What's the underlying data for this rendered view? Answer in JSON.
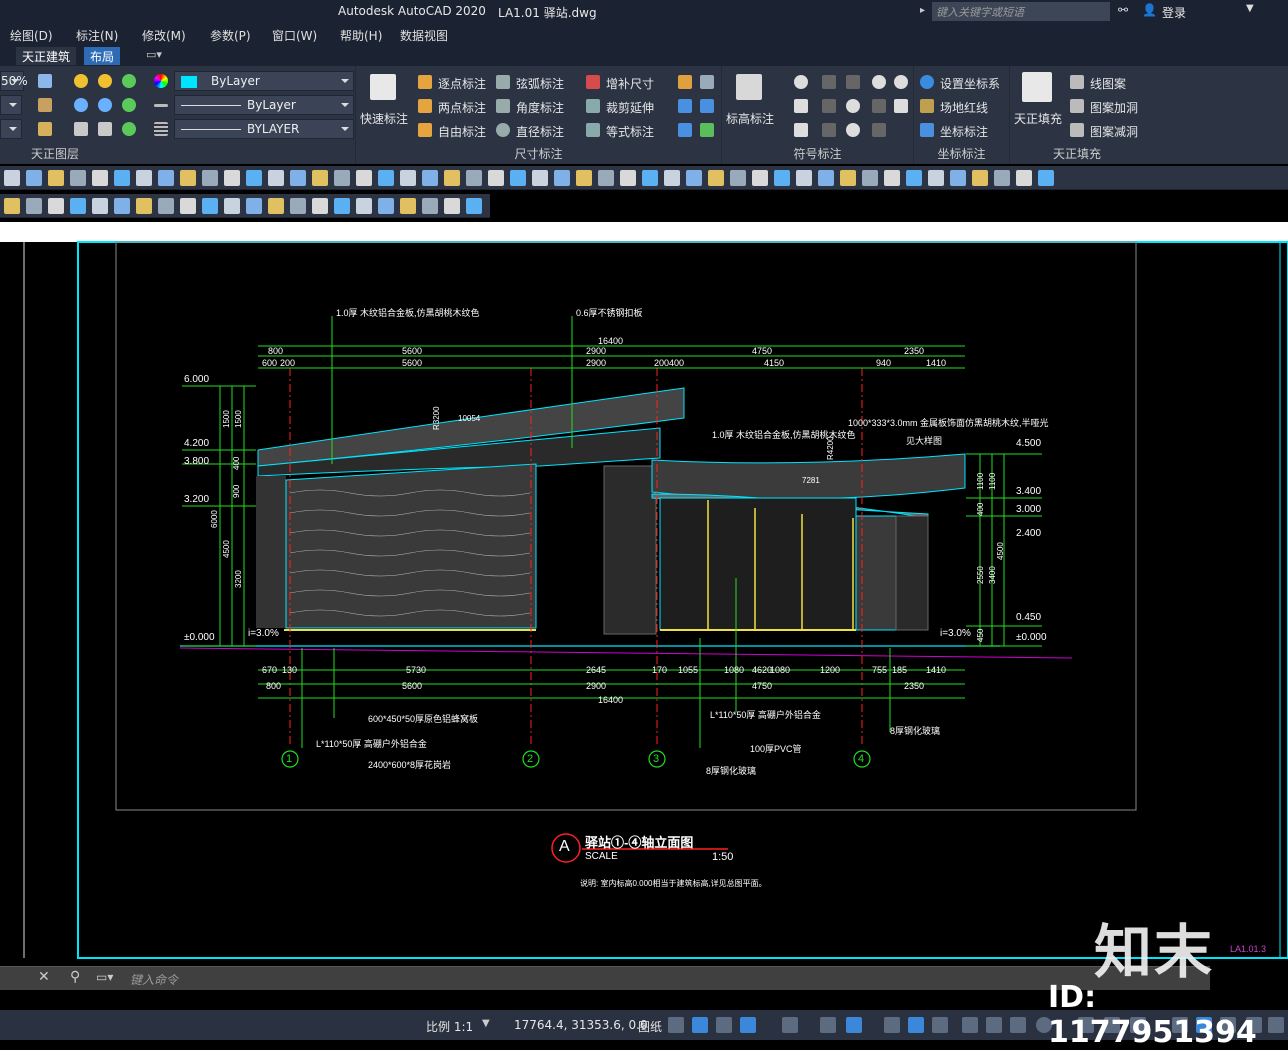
{
  "titlebar": {
    "app": "Autodesk AutoCAD 2020",
    "file": "LA1.01 驿站.dwg",
    "search_placeholder": "键入关键字或短语",
    "login": "登录"
  },
  "menu": [
    "绘图(D)",
    "标注(N)",
    "修改(M)",
    "参数(P)",
    "窗口(W)",
    "帮助(H)",
    "数据视图"
  ],
  "tabs": {
    "t1": "天正建筑",
    "t2": "布局"
  },
  "ribbon": {
    "zoom": "50%",
    "layer_panel": "天正图层",
    "props": {
      "color": "ByLayer",
      "linetype": "ByLayer",
      "lineweight": "BYLAYER"
    },
    "quick_dim": "快速标注",
    "dim_items": [
      "逐点标注",
      "弦弧标注",
      "增补尺寸",
      "两点标注",
      "角度标注",
      "裁剪延伸",
      "自由标注",
      "直径标注",
      "等式标注"
    ],
    "dim_panel": "尺寸标注",
    "elev": "标高标注",
    "symbol_panel": "符号标注",
    "coord_items": [
      "设置坐标系",
      "场地红线",
      "坐标标注"
    ],
    "coord_panel": "坐标标注",
    "fill": "天正填充",
    "fill_items": [
      "线图案",
      "图案加洞",
      "图案减洞"
    ],
    "fill_panel": "天正填充"
  },
  "drawing": {
    "top_note1": "1.0厚 木纹铝合金板,仿黑胡桃木纹色",
    "top_note2": "0.6厚不锈钢扣板",
    "roof_note": "1.0厚 木纹铝合金板,仿黑胡桃木纹色",
    "spec_note": "1000*333*3.0mm 金属板饰面仿黑胡桃木纹,半哑光",
    "dim_top_total": "16400",
    "dim_top_row1": [
      "800",
      "5600",
      "2900",
      "4750",
      "2350"
    ],
    "dim_top_row2": [
      "600",
      "200",
      "5600",
      "2900",
      "200400",
      "4150",
      "940",
      "1410"
    ],
    "elev_left": [
      "6.000",
      "4.200",
      "3.800",
      "3.200",
      "±0.000"
    ],
    "elev_right": [
      "4.500",
      "3.400",
      "3.000",
      "2.400",
      "0.450",
      "±0.000"
    ],
    "vdim_left": [
      "1500",
      "1500",
      "400",
      "900",
      "6000",
      "4500",
      "3200"
    ],
    "vdim_right": [
      "1100",
      "1100",
      "400",
      "4500",
      "2550",
      "3400",
      "450"
    ],
    "slope": "i=3.0%",
    "dim_bot_row1": [
      "670",
      "130",
      "5730",
      "2645",
      "170",
      "1055",
      "1080",
      "4620",
      "1080",
      "1200",
      "755",
      "185",
      "1410"
    ],
    "dim_bot_row2": [
      "800",
      "5600",
      "2900",
      "4750",
      "2350"
    ],
    "dim_bot_total": "16400",
    "bot_notes": [
      "600*450*50厚原色铝蜂窝板",
      "L*110*50厚 高硼户外铝合金",
      "2400*600*8厚花岗岩",
      "100厚PVC管",
      "8厚钢化玻璃",
      "L*110*50厚 高硼户外铝合金",
      "8厚钢化玻璃"
    ],
    "axes": [
      "1",
      "2",
      "3",
      "4"
    ],
    "radius1": "R3200",
    "radius2": "R4200",
    "small1": "10054",
    "small2": "7281",
    "side_note": "见大样图",
    "title_letter": "A",
    "title": "驿站①-④轴立面图",
    "scale_label": "SCALE",
    "scale": "1:50",
    "remark": "说明: 室内标高0.000相当于建筑标高,详见总图平面。",
    "sheet": "LA1.01.3"
  },
  "cmd": {
    "placeholder": "键入命令"
  },
  "status": {
    "scale": "比例 1:1",
    "coords": "17764.4, 31353.6, 0.0",
    "paper": "图纸"
  },
  "watermark": {
    "brand": "知末",
    "id": "ID: 1177951394"
  }
}
